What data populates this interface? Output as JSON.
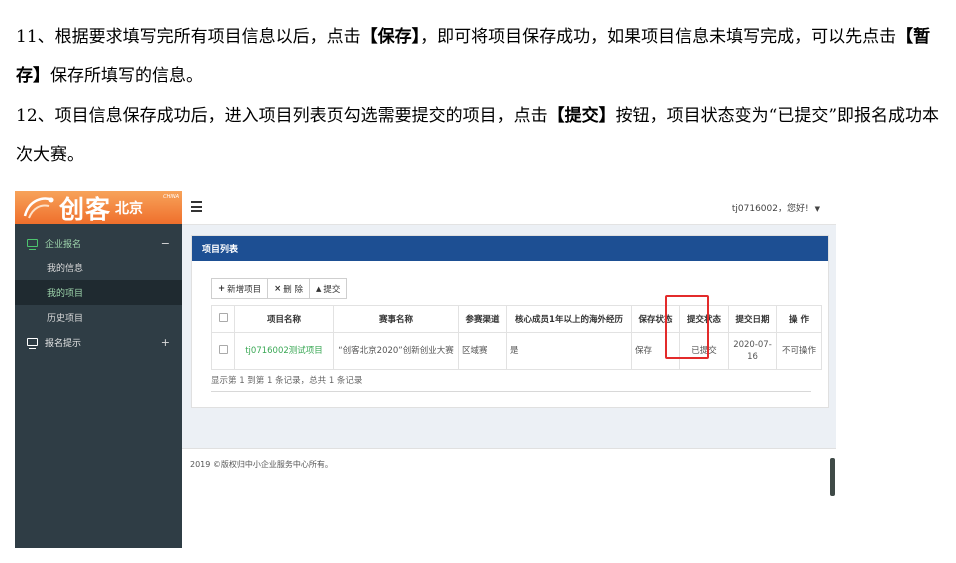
{
  "doc": {
    "p1": {
      "pre": "11、根据要求填写完所有项目信息以后，点击",
      "save": "【保存】",
      "mid": "，即可将项目保存成功，如果项目信息未填写完成，可以先点击",
      "draft": "【暂存】",
      "post": "保存所填写的信息。"
    },
    "p2": {
      "pre": "12、项目信息保存成功后，进入项目列表页勾选需要提交的项目，点击",
      "submit": "【提交】",
      "post": "按钮，项目状态变为“已提交”即报名成功本次大赛。"
    }
  },
  "app": {
    "logo_brand": "创客",
    "logo_city": "北京",
    "logo_tag": "CHINA",
    "user_greeting": "tj0716002，您好!",
    "sidebar": {
      "group1": "企业报名",
      "group1_toggle": "−",
      "items": [
        "我的信息",
        "我的项目",
        "历史项目"
      ],
      "group2": "报名提示",
      "group2_toggle": "+"
    },
    "panel_title": "项目列表",
    "toolbar": {
      "add": "新增项目",
      "add_icon": "+",
      "delete": "删 除",
      "delete_icon": "×",
      "submit": "提交",
      "submit_icon": "▲"
    },
    "table": {
      "headers": [
        "项目名称",
        "赛事名称",
        "参赛渠道",
        "核心成员1年以上的海外经历",
        "保存状态",
        "提交状态",
        "提交日期",
        "操 作"
      ],
      "row": {
        "name": "tj0716002测试项目",
        "contest": "“创客北京2020”创新创业大赛",
        "channel": "区域赛",
        "overseas": "是",
        "save_status": "保存",
        "submit_status": "已提交",
        "date": "2020-07-16",
        "action": "不可操作"
      }
    },
    "pager": "显示第 1 到第 1 条记录，总共 1 条记录",
    "footer": "2019 ©版权归中小企业服务中心所有。",
    "colors": {
      "sidebar": "#2f3d45",
      "panel_header": "#1d4f93",
      "link": "#3aa855",
      "highlight": "#e32b2b",
      "logo": "#ef6f2c"
    }
  }
}
